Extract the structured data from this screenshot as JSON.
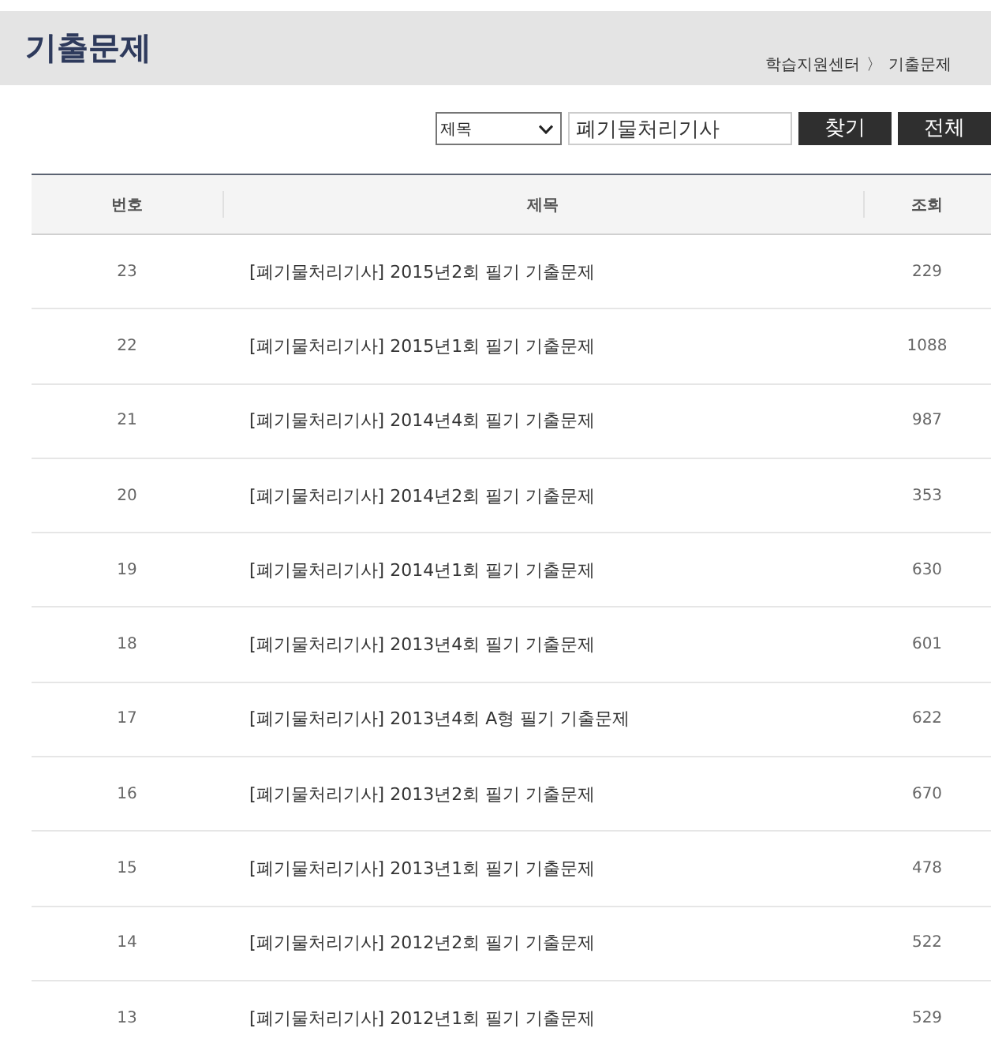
{
  "header": {
    "title": "기출문제",
    "breadcrumb": [
      "학습지원센터",
      "기출문제"
    ],
    "separator": "〉"
  },
  "search": {
    "field_option": "제목",
    "query": "폐기물처리기사",
    "buttons": [
      "찾기",
      "전체"
    ]
  },
  "table": {
    "columns": [
      "번호",
      "제목",
      "조회"
    ],
    "rows": [
      {
        "number": "23",
        "title": "[폐기물처리기사] 2015년2회 필기 기출문제",
        "views": "229"
      },
      {
        "number": "22",
        "title": "[폐기물처리기사] 2015년1회 필기 기출문제",
        "views": "1088"
      },
      {
        "number": "21",
        "title": "[폐기물처리기사] 2014년4회 필기 기출문제",
        "views": "987"
      },
      {
        "number": "20",
        "title": "[폐기물처리기사] 2014년2회 필기 기출문제",
        "views": "353"
      },
      {
        "number": "19",
        "title": "[폐기물처리기사] 2014년1회 필기 기출문제",
        "views": "630"
      },
      {
        "number": "18",
        "title": "[폐기물처리기사] 2013년4회 필기 기출문제",
        "views": "601"
      },
      {
        "number": "17",
        "title": "[폐기물처리기사] 2013년4회 A형 필기 기출문제",
        "views": "622"
      },
      {
        "number": "16",
        "title": "[폐기물처리기사] 2013년2회 필기 기출문제",
        "views": "670"
      },
      {
        "number": "15",
        "title": "[폐기물처리기사] 2013년1회 필기 기출문제",
        "views": "478"
      },
      {
        "number": "14",
        "title": "[폐기물처리기사] 2012년2회 필기 기출문제",
        "views": "522"
      },
      {
        "number": "13",
        "title": "[폐기물처리기사] 2012년1회 필기 기출문제",
        "views": "529"
      }
    ]
  }
}
